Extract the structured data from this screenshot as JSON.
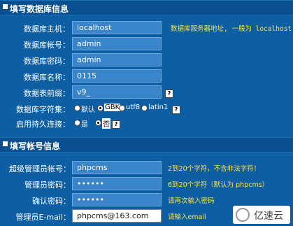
{
  "db_section": {
    "title": "填写数据库信息",
    "host": {
      "label": "数据库主机：",
      "value": "localhost",
      "hint": "数据库服务器地址, 一般为 localhost"
    },
    "user": {
      "label": "数据库帐号：",
      "value": "admin"
    },
    "password": {
      "label": "数据库密码：",
      "value": "admin"
    },
    "name": {
      "label": "数据库名称：",
      "value": "0115"
    },
    "prefix": {
      "label": "数据表前缀：",
      "value": "v9_",
      "help": "?"
    },
    "charset": {
      "label": "数据库字符集：",
      "options": [
        {
          "label": "默认",
          "selected": false
        },
        {
          "label": "GBK",
          "selected": true
        },
        {
          "label": "utf8",
          "selected": false
        },
        {
          "label": "latin1",
          "selected": false
        }
      ],
      "help": "?"
    },
    "persistent": {
      "label": "启用持久连接：",
      "options": [
        {
          "label": "是",
          "selected": false
        },
        {
          "label": "否",
          "selected": true
        }
      ],
      "help": "?"
    }
  },
  "account_section": {
    "title": "填写帐号信息",
    "admin_user": {
      "label": "超级管理员帐号：",
      "value": "phpcms",
      "hint": "2到20个字符，不含非法字符！"
    },
    "admin_pass": {
      "label": "管理员密码：",
      "value": "••••••",
      "hint": "6到20个字符（默认为 phpcms）"
    },
    "confirm_pass": {
      "label": "确认密码：",
      "value": "••••••",
      "hint": "请再次输入密码"
    },
    "email": {
      "label": "管理员E-mail：",
      "value": "phpcms@163.com",
      "hint": "请输入email"
    }
  },
  "logo": {
    "text": "亿速云"
  }
}
